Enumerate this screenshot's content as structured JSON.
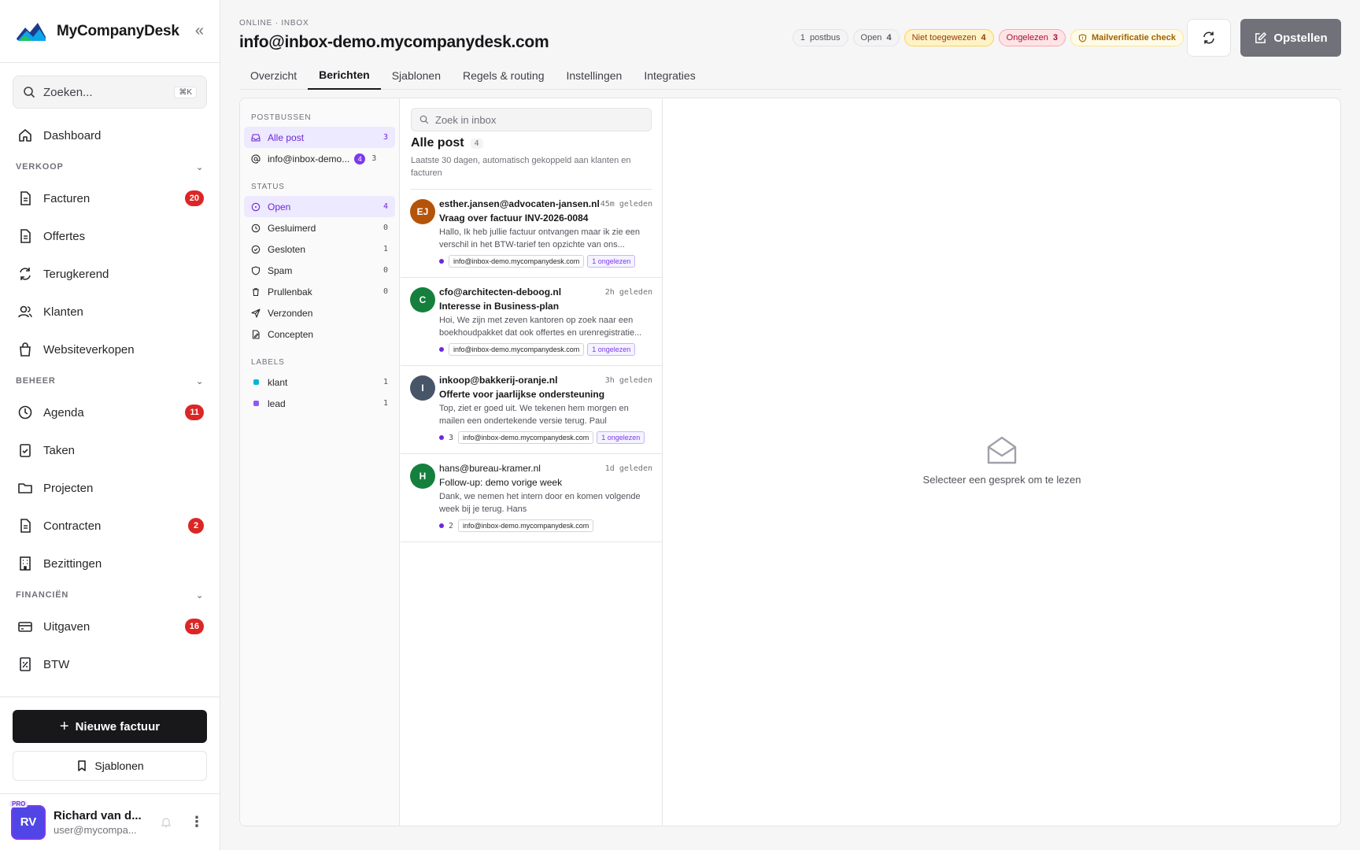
{
  "brand": {
    "name": "MyCompanyDesk"
  },
  "search": {
    "label": "Zoeken...",
    "shortcut": "⌘K"
  },
  "nav": {
    "dashboard": "Dashboard",
    "sections": [
      {
        "title": "VERKOOP",
        "items": [
          {
            "label": "Facturen",
            "badge": "20"
          },
          {
            "label": "Offertes"
          },
          {
            "label": "Terugkerend"
          },
          {
            "label": "Klanten"
          },
          {
            "label": "Websiteverkopen"
          }
        ]
      },
      {
        "title": "BEHEER",
        "items": [
          {
            "label": "Agenda",
            "badge": "11"
          },
          {
            "label": "Taken"
          },
          {
            "label": "Projecten"
          },
          {
            "label": "Contracten",
            "badge": "2"
          },
          {
            "label": "Bezittingen"
          }
        ]
      },
      {
        "title": "FINANCIËN",
        "items": [
          {
            "label": "Uitgaven",
            "badge": "16"
          },
          {
            "label": "BTW"
          }
        ]
      }
    ]
  },
  "actions": {
    "new_invoice": "Nieuwe factuur",
    "templates": "Sjablonen"
  },
  "user": {
    "initials": "RV",
    "pro": "PRO",
    "name": "Richard van d...",
    "email": "user@mycompa..."
  },
  "header": {
    "eyebrow": "ONLINE · INBOX",
    "title": "info@inbox-demo.mycompanydesk.com",
    "chips": {
      "mailboxes": {
        "count": "1",
        "label": "postbus"
      },
      "open": {
        "label": "Open",
        "count": "4"
      },
      "unassigned": {
        "label": "Niet toegewezen",
        "count": "4"
      },
      "unread": {
        "label": "Ongelezen",
        "count": "3"
      },
      "verify": {
        "label": "Mailverificatie check"
      }
    },
    "compose": "Opstellen"
  },
  "tabs": [
    "Overzicht",
    "Berichten",
    "Sjablonen",
    "Regels & routing",
    "Instellingen",
    "Integraties"
  ],
  "active_tab": "Berichten",
  "folders": {
    "mailboxes_title": "POSTBUSSEN",
    "all_mail": {
      "label": "Alle post",
      "count": "3"
    },
    "inbox": {
      "label": "info@inbox-demo...",
      "pill": "4",
      "count": "3"
    },
    "status_title": "STATUS",
    "status": [
      {
        "label": "Open",
        "count": "4"
      },
      {
        "label": "Gesluimerd",
        "count": "0"
      },
      {
        "label": "Gesloten",
        "count": "1"
      },
      {
        "label": "Spam",
        "count": "0"
      },
      {
        "label": "Prullenbak",
        "count": "0"
      },
      {
        "label": "Verzonden"
      },
      {
        "label": "Concepten"
      }
    ],
    "labels_title": "LABELS",
    "labels": [
      {
        "label": "klant",
        "count": "1",
        "color": "#06b6d4"
      },
      {
        "label": "lead",
        "count": "1",
        "color": "#8b5cf6"
      }
    ]
  },
  "list": {
    "search_placeholder": "Zoek in inbox",
    "title": "Alle post",
    "count": "4",
    "subtitle": "Laatste 30 dagen, automatisch gekoppeld aan klanten en facturen",
    "messages": [
      {
        "initials": "EJ",
        "color": "#b45309",
        "from": "esther.jansen@advocaten-jansen.nl",
        "time": "45m geleden",
        "subject": "Vraag over factuur INV-2026-0084",
        "preview": "Hallo, Ik heb jullie factuur ontvangen maar ik zie een verschil in het BTW-tarief ten opzichte van ons...",
        "num": "",
        "mailbox": "info@inbox-demo.mycompanydesk.com",
        "unread": "1 ongelezen"
      },
      {
        "initials": "C",
        "color": "#15803d",
        "from": "cfo@architecten-deboog.nl",
        "time": "2h geleden",
        "subject": "Interesse in Business-plan",
        "preview": "Hoi, We zijn met zeven kantoren op zoek naar een boekhoudpakket dat ook offertes en urenregistratie...",
        "num": "",
        "mailbox": "info@inbox-demo.mycompanydesk.com",
        "unread": "1 ongelezen"
      },
      {
        "initials": "I",
        "color": "#475569",
        "from": "inkoop@bakkerij-oranje.nl",
        "time": "3h geleden",
        "subject": "Offerte voor jaarlijkse ondersteuning",
        "preview": "Top, ziet er goed uit. We tekenen hem morgen en mailen een ondertekende versie terug. Paul",
        "num": "3",
        "mailbox": "info@inbox-demo.mycompanydesk.com",
        "unread": "1 ongelezen"
      },
      {
        "initials": "H",
        "color": "#15803d",
        "from": "hans@bureau-kramer.nl",
        "time": "1d geleden",
        "subject": "Follow-up: demo vorige week",
        "preview": "Dank, we nemen het intern door en komen volgende week bij je terug. Hans",
        "num": "2",
        "mailbox": "info@inbox-demo.mycompanydesk.com",
        "unread": ""
      }
    ]
  },
  "reader": {
    "empty": "Selecteer een gesprek om te lezen"
  }
}
